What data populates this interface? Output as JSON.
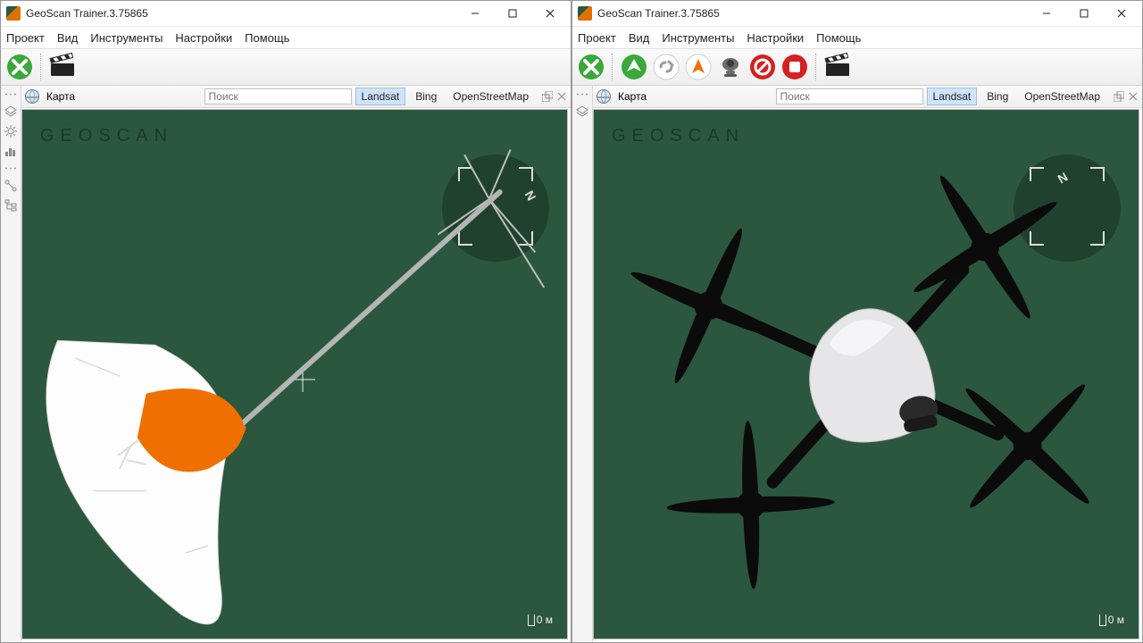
{
  "app": {
    "title": "GeoScan Trainer.3.75865"
  },
  "menu": {
    "project": "Проект",
    "view": "Вид",
    "tools": "Инструменты",
    "settings": "Настройки",
    "help": "Помощь"
  },
  "tabbar": {
    "map_label": "Карта",
    "search_placeholder": "Поиск",
    "layers": {
      "landsat": "Landsat",
      "bing": "Bing",
      "osm": "OpenStreetMap"
    },
    "active_layer": "landsat"
  },
  "viewport": {
    "watermark": "GEOSCAN",
    "scale_label": "0 м"
  },
  "left_window": {
    "toolbar_buttons": [
      "disconnect",
      "record"
    ]
  },
  "right_window": {
    "toolbar_buttons": [
      "disconnect",
      "takeoff",
      "link",
      "point",
      "camera",
      "cancel",
      "stop",
      "record"
    ]
  },
  "colors": {
    "viewport_bg": "#2b573e",
    "accent_green": "#3aa83a",
    "accent_red": "#d42020",
    "accent_orange": "#ef7000",
    "accent_grey": "#9a9a9a"
  }
}
